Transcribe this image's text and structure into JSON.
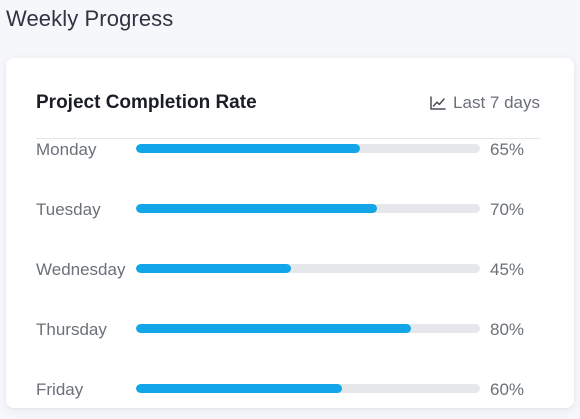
{
  "page": {
    "title": "Weekly Progress"
  },
  "card": {
    "title": "Project Completion Rate",
    "period_label": "Last 7 days",
    "period_icon": "line-chart-icon"
  },
  "colors": {
    "accent": "#12a5e8",
    "track": "#e6e7ea",
    "muted_text": "#6b7078"
  },
  "progress_rows": [
    {
      "day": "Monday",
      "value_label": "65%",
      "progress": 65
    },
    {
      "day": "Tuesday",
      "value_label": "70%",
      "progress": 70
    },
    {
      "day": "Wednesday",
      "value_label": "45%",
      "progress": 45
    },
    {
      "day": "Thursday",
      "value_label": "80%",
      "progress": 80
    },
    {
      "day": "Friday",
      "value_label": "60%",
      "progress": 60
    }
  ]
}
